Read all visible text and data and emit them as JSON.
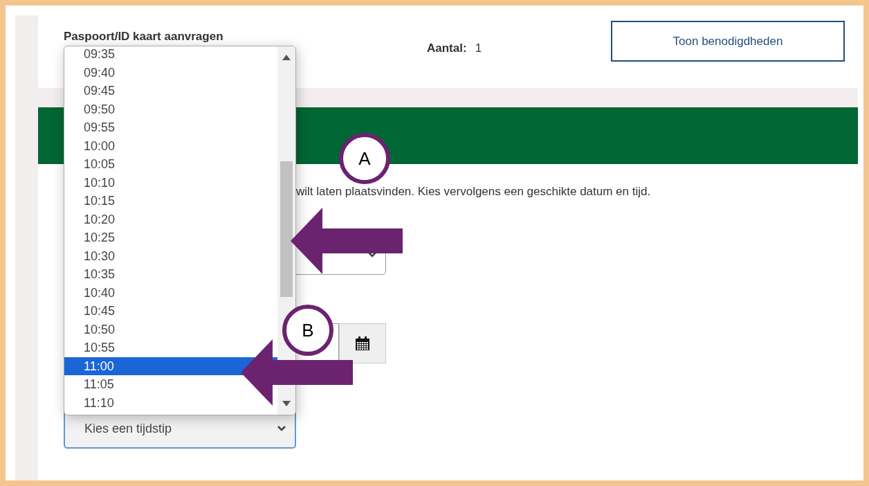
{
  "header": {
    "title": "Paspoort/ID kaart aanvragen",
    "quantity_label": "Aantal:",
    "quantity_value": "1",
    "button": "Toon benodigdheden"
  },
  "intro": "wilt laten plaatsvinden. Kies vervolgens een geschikte datum en tijd.",
  "time_list": {
    "items": [
      {
        "label": "09:35",
        "selected": false
      },
      {
        "label": "09:40",
        "selected": false
      },
      {
        "label": "09:45",
        "selected": false
      },
      {
        "label": "09:50",
        "selected": false
      },
      {
        "label": "09:55",
        "selected": false
      },
      {
        "label": "10:00",
        "selected": false
      },
      {
        "label": "10:05",
        "selected": false
      },
      {
        "label": "10:10",
        "selected": false
      },
      {
        "label": "10:15",
        "selected": false
      },
      {
        "label": "10:20",
        "selected": false
      },
      {
        "label": "10:25",
        "selected": false
      },
      {
        "label": "10:30",
        "selected": false
      },
      {
        "label": "10:35",
        "selected": false
      },
      {
        "label": "10:40",
        "selected": false
      },
      {
        "label": "10:45",
        "selected": false
      },
      {
        "label": "10:50",
        "selected": false
      },
      {
        "label": "10:55",
        "selected": false
      },
      {
        "label": "11:00",
        "selected": true
      },
      {
        "label": "11:05",
        "selected": false
      },
      {
        "label": "11:10",
        "selected": false
      }
    ]
  },
  "time_select": {
    "placeholder": "Kies een tijdstip"
  },
  "annotations": [
    {
      "label": "A"
    },
    {
      "label": "B"
    }
  ]
}
